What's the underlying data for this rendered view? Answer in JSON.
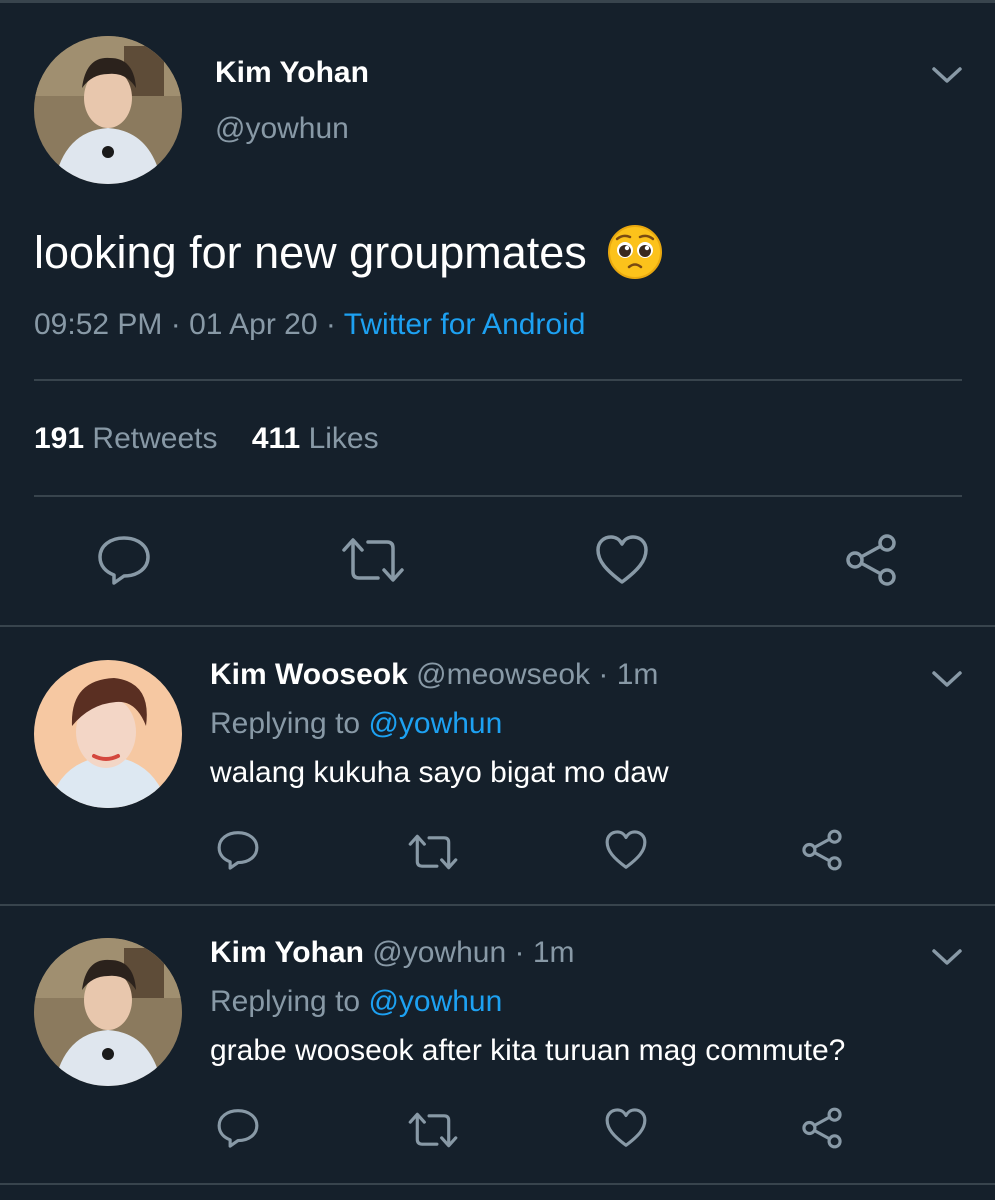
{
  "main_tweet": {
    "display_name": "Kim Yohan",
    "handle": "@yowhun",
    "text": "looking for new groupmates",
    "emoji": "pleading-face-emoji",
    "time": "09:52 PM",
    "date": "01 Apr 20",
    "separator": "·",
    "source": "Twitter for Android",
    "retweets_count": "191",
    "retweets_label": "Retweets",
    "likes_count": "411",
    "likes_label": "Likes"
  },
  "replies": [
    {
      "display_name": "Kim Wooseok",
      "handle": "@meowseok",
      "time_sep": "·",
      "time": "1m",
      "replying_prefix": "Replying to",
      "replying_handle": "@yowhun",
      "text": "walang kukuha sayo bigat mo daw"
    },
    {
      "display_name": "Kim Yohan",
      "handle": "@yowhun",
      "time_sep": "·",
      "time": "1m",
      "replying_prefix": "Replying to",
      "replying_handle": "@yowhun",
      "text": "grabe wooseok after kita turuan mag commute?"
    }
  ],
  "icons": [
    "reply-icon",
    "retweet-icon",
    "like-icon",
    "share-icon",
    "chevron-down-icon"
  ],
  "colors": {
    "background": "#15202b",
    "text": "#ffffff",
    "muted": "#8899a6",
    "link": "#1da1f2",
    "divider": "#38444d"
  }
}
